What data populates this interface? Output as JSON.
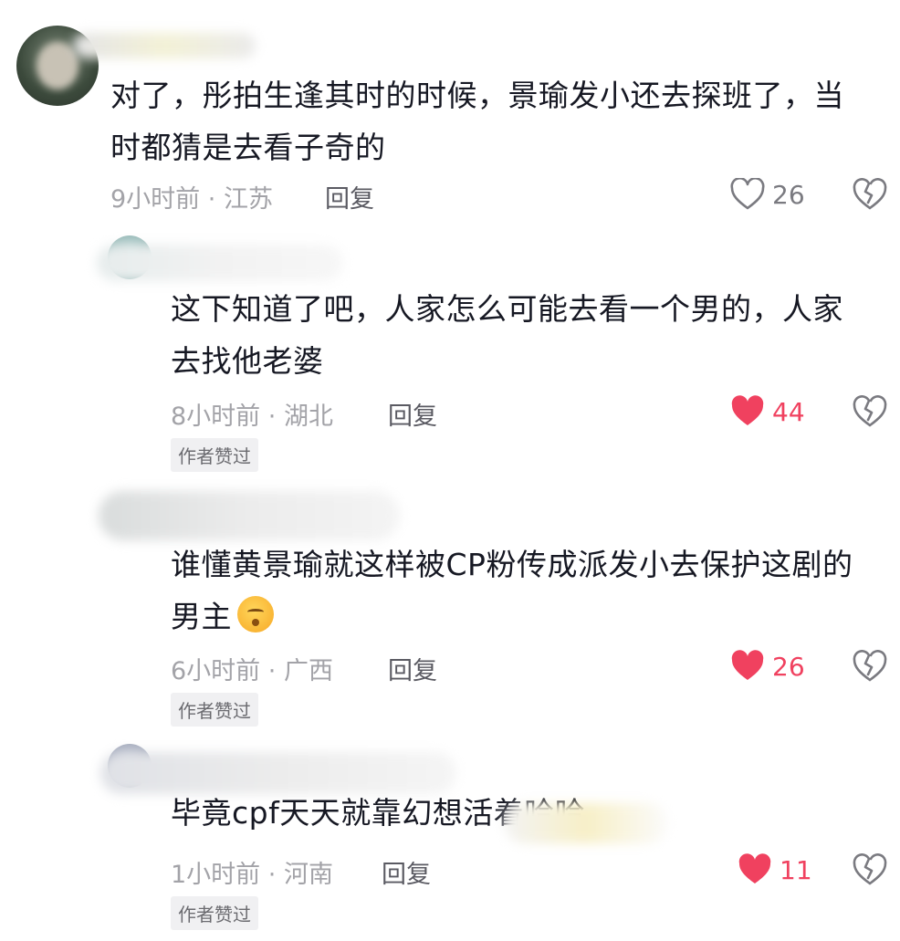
{
  "comments": [
    {
      "text_line1": "对了，彤拍生逢其时的时候，景瑜发小还去探班了，当",
      "text_line2": "时都猜是去看子奇的",
      "time": "9小时前",
      "location": "江苏",
      "reply_label": "回复",
      "likes": "26",
      "liked": false,
      "author_liked": false
    },
    {
      "text_line1": "这下知道了吧，人家怎么可能去看一个男的，人家",
      "text_line2": "去找他老婆",
      "time": "8小时前",
      "location": "湖北",
      "reply_label": "回复",
      "likes": "44",
      "liked": true,
      "author_liked": true,
      "badge": "作者赞过"
    },
    {
      "text_line1": "谁懂黄景瑜就这样被CP粉传成派发小去保护这剧的",
      "text_line2": "男主",
      "emoji": "smiling-face-emoji",
      "time": "6小时前",
      "location": "广西",
      "reply_label": "回复",
      "likes": "26",
      "liked": true,
      "author_liked": true,
      "badge": "作者赞过"
    },
    {
      "text_line1": "毕竟cpf天天就靠幻想活着哈哈",
      "time": "1小时前",
      "location": "河南",
      "reply_label": "回复",
      "likes": "11",
      "liked": true,
      "author_liked": true,
      "badge": "作者赞过"
    }
  ],
  "separator": "·",
  "colors": {
    "liked_red": "#f0415f",
    "meta_gray": "#a3a3a8",
    "text": "#161823"
  },
  "icons": {
    "like": "heart-icon",
    "dislike": "broken-heart-icon"
  }
}
